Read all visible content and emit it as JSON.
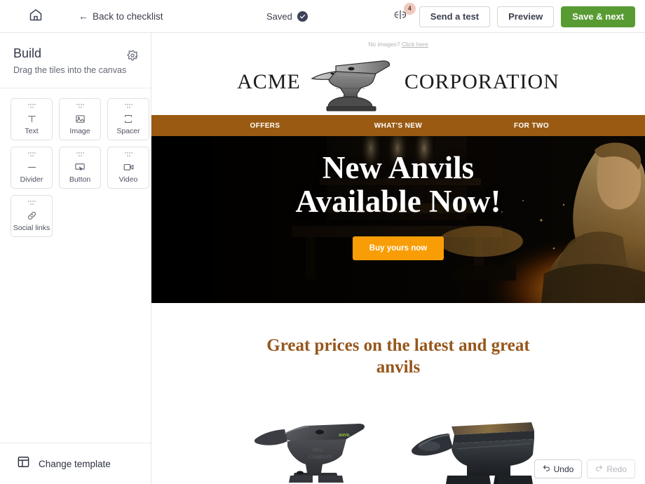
{
  "topbar": {
    "home_icon": "home-icon",
    "back_label": "Back to checklist",
    "back_arrow": "←",
    "saved_label": "Saved",
    "saved_icon": "check-circle-icon",
    "comments_icon": "comment-toggle-icon",
    "comments_badge": "4",
    "send_test_label": "Send a test",
    "preview_label": "Preview",
    "save_next_label": "Save & next",
    "primary_color": "#589b33"
  },
  "sidebar": {
    "title": "Build",
    "subtitle": "Drag the tiles into the canvas",
    "settings_icon": "gear-icon",
    "tiles": [
      {
        "label": "Text",
        "icon": "text-icon"
      },
      {
        "label": "Image",
        "icon": "image-icon"
      },
      {
        "label": "Spacer",
        "icon": "spacer-icon"
      },
      {
        "label": "Divider",
        "icon": "divider-icon"
      },
      {
        "label": "Button",
        "icon": "button-icon"
      },
      {
        "label": "Video",
        "icon": "video-icon"
      },
      {
        "label": "Social links",
        "icon": "link-icon"
      }
    ],
    "footer": {
      "label": "Change template",
      "icon": "layout-template-icon"
    }
  },
  "canvas": {
    "preheader": {
      "text": "No images?",
      "link": "Click here"
    },
    "logo": {
      "word_left": "ACME",
      "word_right": "CORPORATION",
      "image_alt": "anvil-logo"
    },
    "nav": {
      "background": "#9a5a12",
      "items": [
        "OFFERS",
        "WHAT'S NEW",
        "FOR TWO"
      ]
    },
    "hero": {
      "headline_line1": "New Anvils",
      "headline_line2": "Available Now!",
      "cta_label": "Buy yours now",
      "cta_color": "#f99d06",
      "image_alt": "blacksmith-forging-at-anvil"
    },
    "promo": {
      "heading": "Great prices on the latest and great anvils",
      "heading_color": "#96561b",
      "products": [
        {
          "alt": "light-grey-anvil-product-photo"
        },
        {
          "alt": "dark-steel-anvil-product-photo"
        }
      ]
    }
  },
  "history": {
    "undo_label": "Undo",
    "undo_icon": "undo-arrow-icon",
    "undo_enabled": true,
    "redo_label": "Redo",
    "redo_icon": "redo-arrow-icon",
    "redo_enabled": false
  }
}
